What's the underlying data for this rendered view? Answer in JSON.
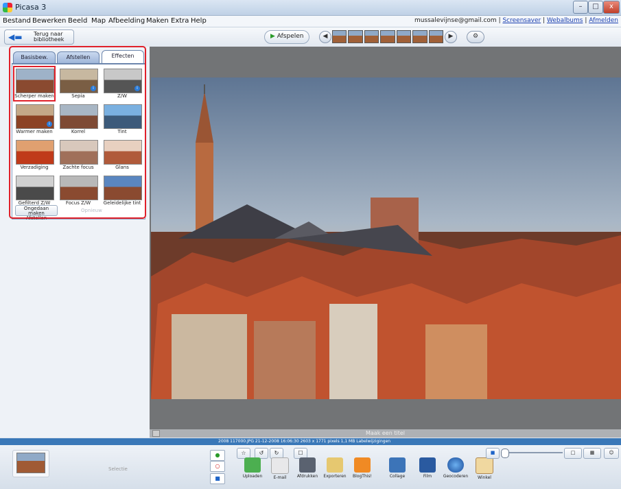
{
  "window": {
    "title": "Picasa 3",
    "minimize": "–",
    "maximize": "□",
    "close": "x"
  },
  "menu": {
    "items": [
      "Bestand",
      "Bewerken",
      "Beeld",
      "Map",
      "Afbeelding",
      "Maken",
      "Extra",
      "Help"
    ],
    "account": "mussalevijnse@gmail.com",
    "links": [
      "Screensaver",
      "Webalbums",
      "Afmelden"
    ]
  },
  "toolbar": {
    "back_label": "Terug naar\nbibliotheek",
    "play_label": "Afspelen"
  },
  "editor": {
    "tabs": [
      "Basisbew.",
      "Afstellen",
      "Effecten"
    ],
    "active_tab": "Effecten",
    "effects": [
      {
        "label": "Scherper maken",
        "badge": ""
      },
      {
        "label": "Sepia",
        "badge": "i"
      },
      {
        "label": "Z/W",
        "badge": "i"
      },
      {
        "label": "Warmer maken",
        "badge": "i"
      },
      {
        "label": "Korrel",
        "badge": ""
      },
      {
        "label": "Tint",
        "badge": ""
      },
      {
        "label": "Verzadiging",
        "badge": ""
      },
      {
        "label": "Zachte focus",
        "badge": ""
      },
      {
        "label": "Glans",
        "badge": ""
      },
      {
        "label": "Gefilterd Z/W",
        "badge": ""
      },
      {
        "label": "Focus Z/W",
        "badge": ""
      },
      {
        "label": "Geleidelijke tint",
        "badge": ""
      }
    ],
    "undo_label": "Ongedaan maken\nAfstellen",
    "redo_label": "Opnieuw"
  },
  "viewer": {
    "caption_placeholder": "Maak een titel"
  },
  "status": {
    "text": "2008 117000.JPG    21-12-2008 16:06:30    2603 x 1771 pixels    1,1 MB    Labelwijzigingen"
  },
  "tray": {
    "selection_label": "Selectie",
    "actions": [
      "Uploaden",
      "E-mail",
      "Afdrukken",
      "Exporteren",
      "BlogThis!",
      "Collage",
      "Film",
      "Geocoderen",
      "Winkel"
    ]
  },
  "colors": {
    "highlight": "#e0202a",
    "statusbar": "#3a78b8"
  }
}
